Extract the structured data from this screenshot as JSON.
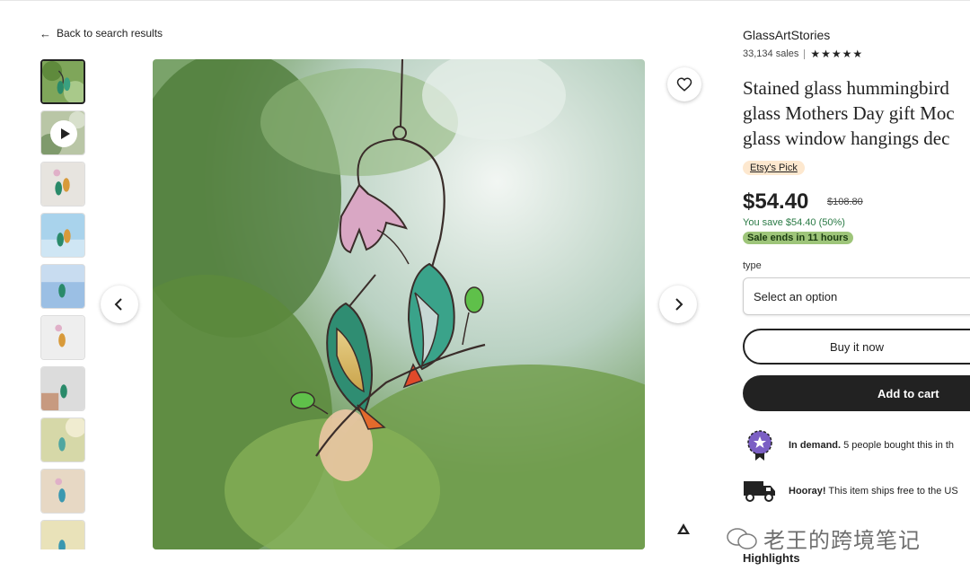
{
  "nav": {
    "back_label": "Back to search results"
  },
  "shop": {
    "name": "GlassArtStories",
    "sales": "33,134 sales",
    "rating_stars": "★★★★★",
    "rating_value": 5
  },
  "listing": {
    "title_lines": [
      "Stained glass hummingbird",
      "glass Mothers Day gift Moc",
      "glass window hangings dec"
    ],
    "badge": "Etsy's Pick",
    "price": "$54.40",
    "original_price": "$108.80",
    "savings": "You save $54.40 (50%)",
    "sale_badge": "Sale ends in 11 hours"
  },
  "variation": {
    "label": "type",
    "placeholder": "Select an option"
  },
  "actions": {
    "buy_now": "Buy it now",
    "add_to_cart": "Add to cart"
  },
  "notices": [
    {
      "bold": "In demand.",
      "text": " 5 people bought this in th",
      "icon": "award-ribbon-icon"
    },
    {
      "bold": "Hooray!",
      "text": " This item ships free to the US",
      "icon": "delivery-truck-icon"
    }
  ],
  "section": {
    "highlights": "Highlights"
  },
  "watermark": {
    "text": "老王的跨境笔记"
  },
  "colors": {
    "accent_dark": "#222222",
    "sale_green": "#9ec57a",
    "save_text": "#2a7a45",
    "pick_bg": "#fde8cf",
    "award_purple": "#7b5fc4"
  },
  "gallery": {
    "thumbnail_count": 10,
    "video_thumbnail_index": 1
  }
}
